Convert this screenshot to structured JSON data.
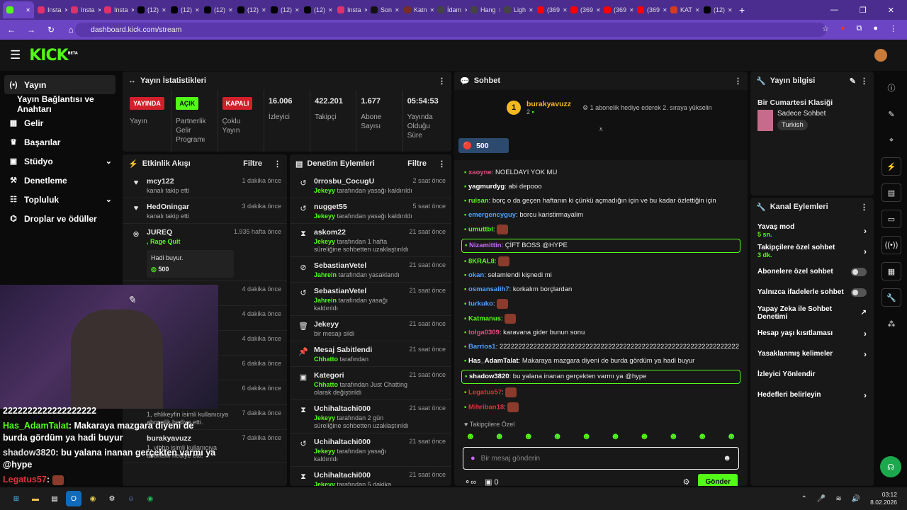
{
  "browser": {
    "tabs": [
      {
        "label": "",
        "color": "#53fc18"
      },
      {
        "label": "Insta",
        "color": "#e1306c"
      },
      {
        "label": "Insta",
        "color": "#e1306c"
      },
      {
        "label": "Insta",
        "color": "#e1306c"
      },
      {
        "label": "(12)",
        "color": "#000000"
      },
      {
        "label": "(12)",
        "color": "#000000"
      },
      {
        "label": "(12)",
        "color": "#000000"
      },
      {
        "label": "(12)",
        "color": "#000000"
      },
      {
        "label": "(12)",
        "color": "#000000"
      },
      {
        "label": "(12)",
        "color": "#000000"
      },
      {
        "label": "Insta",
        "color": "#e1306c"
      },
      {
        "label": "Son",
        "color": "#111111"
      },
      {
        "label": "Katn",
        "color": "#7a2b2b"
      },
      {
        "label": "İdam",
        "color": "#444444"
      },
      {
        "label": "Hang",
        "color": "#444444"
      },
      {
        "label": "Ligh",
        "color": "#444444"
      },
      {
        "label": "(369",
        "color": "#ff0000"
      },
      {
        "label": "(369",
        "color": "#ff0000"
      },
      {
        "label": "(369",
        "color": "#ff0000"
      },
      {
        "label": "(369",
        "color": "#ff0000"
      },
      {
        "label": "KAT",
        "color": "#d83a1e"
      },
      {
        "label": "(12)",
        "color": "#000000"
      }
    ],
    "url": "dashboard.kick.com/stream"
  },
  "header": {
    "logo": "KICK",
    "logo_tag": "BETA"
  },
  "sidebar": {
    "items": [
      {
        "label": "Yayın",
        "icon": "(•)"
      },
      {
        "label": "Yayın Bağlantısı ve Anahtarı",
        "icon": ""
      },
      {
        "label": "Gelir",
        "icon": "▦"
      },
      {
        "label": "Başarılar",
        "icon": "♛"
      },
      {
        "label": "Stüdyo",
        "icon": "▣",
        "chev": "⌄"
      },
      {
        "label": "Denetleme",
        "icon": "⚒"
      },
      {
        "label": "Topluluk",
        "icon": "☷",
        "chev": "⌄"
      },
      {
        "label": "Droplar ve ödüller",
        "icon": "⌬"
      }
    ]
  },
  "stats": {
    "title": "Yayın İstatistikleri",
    "cols": [
      {
        "badge": "YAYINDA",
        "type": "red",
        "label": "Yayın"
      },
      {
        "badge": "AÇIK",
        "type": "green",
        "label": "Partnerlik Gelir Programı"
      },
      {
        "badge": "KAPALI",
        "type": "red",
        "label": "Çoklu Yayın"
      },
      {
        "value": "16.006",
        "label": "İzleyici"
      },
      {
        "value": "422.201",
        "label": "Takipçi"
      },
      {
        "value": "1.677",
        "label": "Abone Sayısı"
      },
      {
        "value": "05:54:53",
        "label": "Yayında Olduğu Süre"
      }
    ]
  },
  "activity": {
    "title": "Etkinlik Akışı",
    "filter": "Filtre",
    "items": [
      {
        "name": "mcy122",
        "sub": "kanalı takip etti",
        "time": "1 dakika önce",
        "icon": "♥"
      },
      {
        "name": "HedOningar",
        "sub": "kanalı takip etti",
        "time": "3 dakika önce",
        "icon": "♥"
      },
      {
        "name": "JUREQ",
        "sub": ", Rage Quit",
        "time": "1.935 hafta önce",
        "icon": "⊗"
      },
      {
        "name": "",
        "sub": "",
        "time": "4 dakika önce",
        "icon": ""
      },
      {
        "name": "",
        "sub": "",
        "time": "4 dakika önce",
        "icon": ""
      },
      {
        "name": "",
        "sub": "",
        "time": "4 dakika önce",
        "icon": ""
      },
      {
        "name": "",
        "sub": "",
        "time": "6 dakika önce",
        "icon": ""
      },
      {
        "name": "",
        "sub": "kanalı takip etti",
        "time": "6 dakika önce",
        "icon": ""
      },
      {
        "name": "",
        "sub": "1, ehlikeyfin isimli kullanıcıya abonelik hediye etti.",
        "time": "7 dakika önce",
        "icon": ""
      },
      {
        "name": "burakyavuzz",
        "sub": "1, vibbo isimli kullanıcıya abonelik hediye etti.",
        "time": "7 dakika önce",
        "icon": ""
      }
    ],
    "note": "Hadi buyur.",
    "note_amount": "500"
  },
  "moderation": {
    "title": "Denetim Eylemleri",
    "filter": "Filtre",
    "items": [
      {
        "name": "0rrosbu_CocugU",
        "sub1": "Jekeyy",
        "sub2": " tarafından yasağı kaldırıldı",
        "time": "2 saat önce",
        "icon": "↺"
      },
      {
        "name": "nugget55",
        "sub1": "Jekeyy",
        "sub2": " tarafından yasağı kaldırıldı",
        "time": "5 saat önce",
        "icon": "↺"
      },
      {
        "name": "askom22",
        "sub1": "Jekeyy",
        "sub2": " tarafından 1 hafta süreliğine sohbetten uzaklaştırıldı",
        "time": "21 saat önce",
        "icon": "⧗"
      },
      {
        "name": "SebastianVetel",
        "sub1": "Jahrein",
        "sub2": " tarafından yasaklandı",
        "time": "21 saat önce",
        "icon": "⊘"
      },
      {
        "name": "SebastianVetel",
        "sub1": "Jahrein",
        "sub2": " tarafından yasağı kaldırıldı",
        "time": "21 saat önce",
        "icon": "↺"
      },
      {
        "name": "Jekeyy",
        "sub1": "",
        "sub2": "bir mesajı sildi",
        "time": "21 saat önce",
        "icon": "🗑"
      },
      {
        "name": "Mesaj Sabitlendi",
        "sub1": "Chhatto",
        "sub2": " tarafından",
        "time": "21 saat önce",
        "icon": "📌"
      },
      {
        "name": "Kategori",
        "sub1": "Chhatto",
        "sub2": " tarafından Just Chatting olarak değiştirildi",
        "time": "21 saat önce",
        "icon": "▣"
      },
      {
        "name": "Uchihaltachi000",
        "sub1": "Jekeyy",
        "sub2": " tarafından 2 gün süreliğine sohbetten uzaklaştırıldı",
        "time": "21 saat önce",
        "icon": "⧗"
      },
      {
        "name": "Uchihaltachi000",
        "sub1": "Jekeyy",
        "sub2": " tarafından yasağı kaldırıldı",
        "time": "21 saat önce",
        "icon": "↺"
      },
      {
        "name": "Uchihaltachi000",
        "sub1": "Jekeyy",
        "sub2": " tarafından 5 dakika süreliğine sohbetten uzaklaştırıldı",
        "time": "21 saat önce",
        "icon": "⧗"
      }
    ]
  },
  "chat": {
    "title": "Sohbet",
    "pinned_user": "burakyavuzz",
    "pinned_count": "2",
    "pinned_text": "1 abonelik hediye ederek 2. sıraya yükselin",
    "kicks": "500",
    "messages": [
      {
        "user": "xaoyne",
        "color": "#e04f7f",
        "text": "NOELDAYI YOK MU"
      },
      {
        "user": "yagmurdyg",
        "color": "#ffffff",
        "text": "abi depooo"
      },
      {
        "user": "ruisan",
        "color": "#53fc18",
        "text": "borç o da geçen haftanın ki çünkü açmadığın için ve bu kadar özlettiğin için"
      },
      {
        "user": "emergencyguy",
        "color": "#4fa3ff",
        "text": "borcu karistirmayalim"
      },
      {
        "user": "umuttbl",
        "color": "#53fc18",
        "text": ""
      },
      {
        "user": "Nizamittin",
        "color": "#c86bff",
        "text": "ÇİFT BOSS @HYPE",
        "hl": true
      },
      {
        "user": "8KRAL8",
        "color": "#53fc18",
        "text": ""
      },
      {
        "user": "okan",
        "color": "#4fa3ff",
        "text": "selamlendi kişnedi mi"
      },
      {
        "user": "osmansalih7",
        "color": "#4fa3ff",
        "text": "korkalım borçlardan"
      },
      {
        "user": "turkuko",
        "color": "#4fa3ff",
        "text": ""
      },
      {
        "user": "Katmanus",
        "color": "#53fc18",
        "text": ""
      },
      {
        "user": "tolga0309",
        "color": "#e04f7f",
        "text": "karavana gider bunun sonu"
      },
      {
        "user": "Barrios1",
        "color": "#4fa3ff",
        "text": "2222222222222222222222222222222222222222222222222222222222222222"
      },
      {
        "user": "Has_AdamTalat",
        "color": "#ffffff",
        "text": "Makaraya mazgara diyeni de burda gördüm ya hadi buyur"
      },
      {
        "user": "shadow3820",
        "color": "#ffffff",
        "text": "bu yalana inanan gerçekten varmı ya @hype",
        "hl": true
      },
      {
        "user": "Legatus57",
        "color": "#e0323b",
        "text": ""
      },
      {
        "user": "Mihriban18",
        "color": "#e0323b",
        "text": ""
      }
    ],
    "followers_only": "Takipçilere Özel",
    "input_placeholder": "Bir mesaj gönderin",
    "points": "0",
    "send": "Gönder"
  },
  "stream_info": {
    "title": "Yayın bilgisi",
    "stream_title": "Bir Cumartesi Klasiği",
    "category": "Sadece Sohbet",
    "tag": "Turkish"
  },
  "channel_actions": {
    "title": "Kanal Eylemleri",
    "items": [
      {
        "label": "Yavaş mod",
        "sub": "5 sn.",
        "ctl": "chev"
      },
      {
        "label": "Takipçilere özel sohbet",
        "sub": "3 dk.",
        "ctl": "chev"
      },
      {
        "label": "Abonelere özel sohbet",
        "sub": "",
        "ctl": "toggle"
      },
      {
        "label": "Yalnızca ifadelerle sohbet",
        "sub": "",
        "ctl": "toggle"
      },
      {
        "label": "Yapay Zeka ile Sohbet Denetimi",
        "sub": "",
        "ctl": "ext"
      },
      {
        "label": "Hesap yaşı kısıtlaması",
        "sub": "",
        "ctl": "chev"
      },
      {
        "label": "Yasaklanmış kelimeler",
        "sub": "",
        "ctl": "chev"
      },
      {
        "label": "İzleyici Yönlendir",
        "sub": "",
        "ctl": ""
      },
      {
        "label": "Hedefleri belirleyin",
        "sub": "",
        "ctl": "chev"
      }
    ]
  },
  "overlay_chat": [
    {
      "user": "",
      "text": "2222222222222222222"
    },
    {
      "user": "Has_AdamTalat",
      "color": "#53fc18",
      "text": ": Makaraya mazgara diyeni de burda gördüm ya hadi buyur"
    },
    {
      "user": "shadow3820",
      "color": "#e0e0e0",
      "text": ": bu yalana inanan gerçekten varmı ya @hype"
    },
    {
      "user": "Legatus57",
      "color": "#e0323b",
      "text": ":"
    }
  ],
  "taskbar": {
    "time": "03:12",
    "date": "8.02.2026"
  }
}
